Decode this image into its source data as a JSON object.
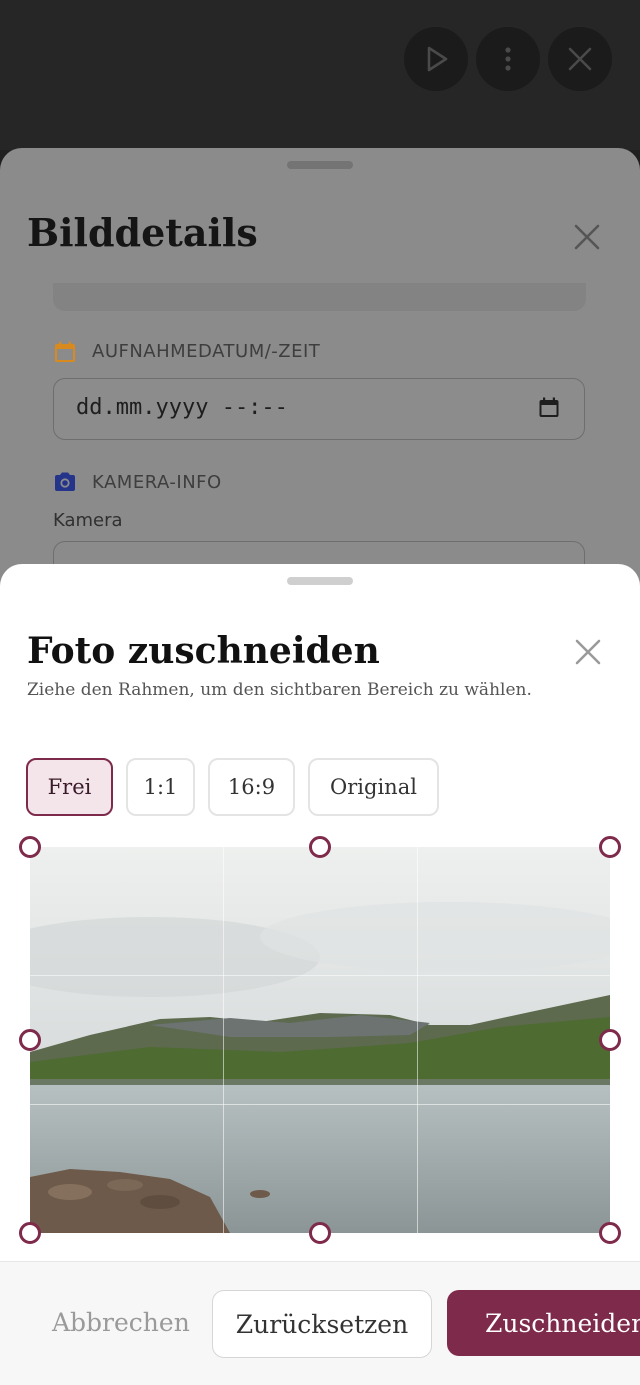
{
  "colors": {
    "accent": "#7e2a4b",
    "calendar_icon": "#d98a1e",
    "camera_icon": "#24348a"
  },
  "top_bar": {
    "icons": [
      "play-icon",
      "more-vertical-icon",
      "close-icon"
    ]
  },
  "details_sheet": {
    "title": "Bilddetails",
    "date_section_label": "AUFNAHMEDATUM/-ZEIT",
    "date_placeholder": "dd.mm.yyyy --:--",
    "camera_section_label": "KAMERA-INFO",
    "camera_label": "Kamera"
  },
  "crop_sheet": {
    "title": "Foto zuschneiden",
    "subtitle": "Ziehe den Rahmen, um den sichtbaren Bereich zu wählen.",
    "ratios": [
      "Frei",
      "1:1",
      "16:9",
      "Original"
    ],
    "selected_ratio": "Frei"
  },
  "footer": {
    "cancel": "Abbrechen",
    "reset": "Zurücksetzen",
    "crop": "Zuschneiden"
  }
}
